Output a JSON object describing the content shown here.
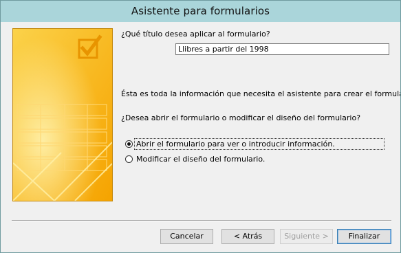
{
  "window": {
    "title": "Asistente para formularios"
  },
  "form": {
    "question_title": "¿Qué título desea aplicar al formulario?",
    "title_value": "Llibres a partir del 1998",
    "info_text": "Ésta es toda la información que necesita el asistente para crear el formulario.",
    "question_open": "¿Desea abrir el formulario o modificar el diseño del formulario?",
    "options": [
      {
        "label": "Abrir el formulario para ver o introducir información.",
        "selected": true
      },
      {
        "label": "Modificar el diseño del formulario.",
        "selected": false
      }
    ]
  },
  "buttons": {
    "cancel": "Cancelar",
    "back": "< Atrás",
    "next": "Siguiente >",
    "finish": "Finalizar"
  },
  "colors": {
    "titlebar": "#aad5da",
    "banner_orange": "#f5a800",
    "banner_yellow": "#fde070"
  }
}
